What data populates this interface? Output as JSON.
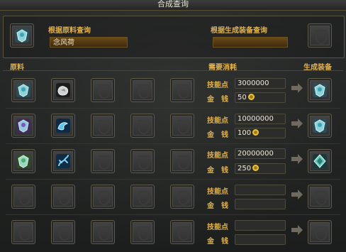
{
  "window": {
    "title": "合成查询"
  },
  "query": {
    "by_material_label": "根据原料查询",
    "by_material_value": "念风荷",
    "by_result_label": "根据生成装备查询",
    "by_result_value": ""
  },
  "columns": {
    "materials": "原料",
    "cost": "需要消耗",
    "result": "生成装备"
  },
  "cost_labels": {
    "skill_points": "技能点",
    "gold": "金　钱"
  },
  "rows": [
    {
      "skill_points": "3000000",
      "gold": "50",
      "filled_materials": 2,
      "has_result": true
    },
    {
      "skill_points": "10000000",
      "gold": "100",
      "filled_materials": 2,
      "has_result": true
    },
    {
      "skill_points": "20000000",
      "gold": "250",
      "filled_materials": 2,
      "has_result": true
    },
    {
      "skill_points": "",
      "gold": "",
      "filled_materials": 0,
      "has_result": false
    },
    {
      "skill_points": "",
      "gold": "",
      "filled_materials": 0,
      "has_result": false
    }
  ],
  "colors": {
    "accent_gold": "#e3b24a",
    "input_brown": "#6a4a17",
    "coin_gold": "#e9c43a"
  },
  "icons": {
    "row1": [
      "teal-armor-gem-icon",
      "silver-ore-icon"
    ],
    "row2": [
      "purple-armor-gem-icon",
      "blue-serpent-icon"
    ],
    "row3": [
      "green-armor-gem-icon",
      "blue-scorpion-icon"
    ],
    "results": [
      "teal-armor-gem-icon",
      "teal-armor-gem-icon",
      "green-crystal-armor-icon"
    ],
    "arrow": "right-arrow-icon",
    "coin": "coin-icon"
  }
}
